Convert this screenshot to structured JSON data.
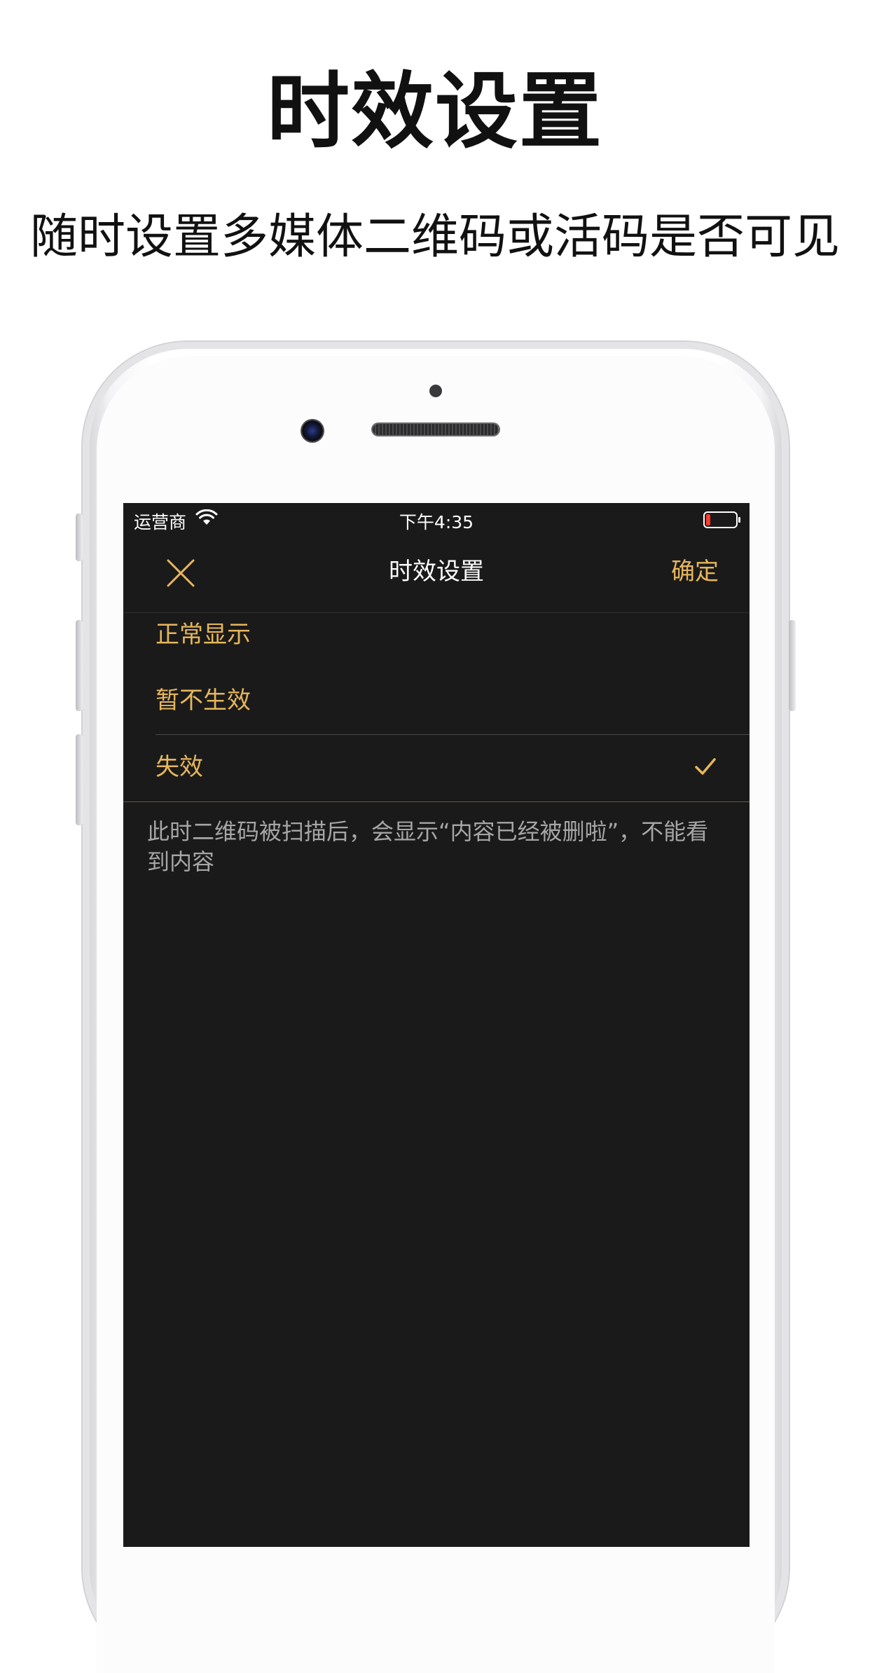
{
  "promo": {
    "title": "时效设置",
    "subtitle": "随时设置多媒体二维码或活码是否可见"
  },
  "status_bar": {
    "carrier": "运营商",
    "time": "下午4:35",
    "icons": [
      "wifi-icon",
      "battery-icon"
    ]
  },
  "nav": {
    "title": "时效设置",
    "confirm_label": "确定",
    "close_icon": "close-icon"
  },
  "options": [
    {
      "label": "正常显示",
      "selected": false
    },
    {
      "label": "暂不生效",
      "selected": false
    },
    {
      "label": "失效",
      "selected": true
    }
  ],
  "description": "此时二维码被扫描后，会显示“内容已经被删啦”，不能看到内容",
  "colors": {
    "accent": "#e6b65c",
    "background": "#1a1a1a",
    "battery_low": "#ff3b30"
  }
}
